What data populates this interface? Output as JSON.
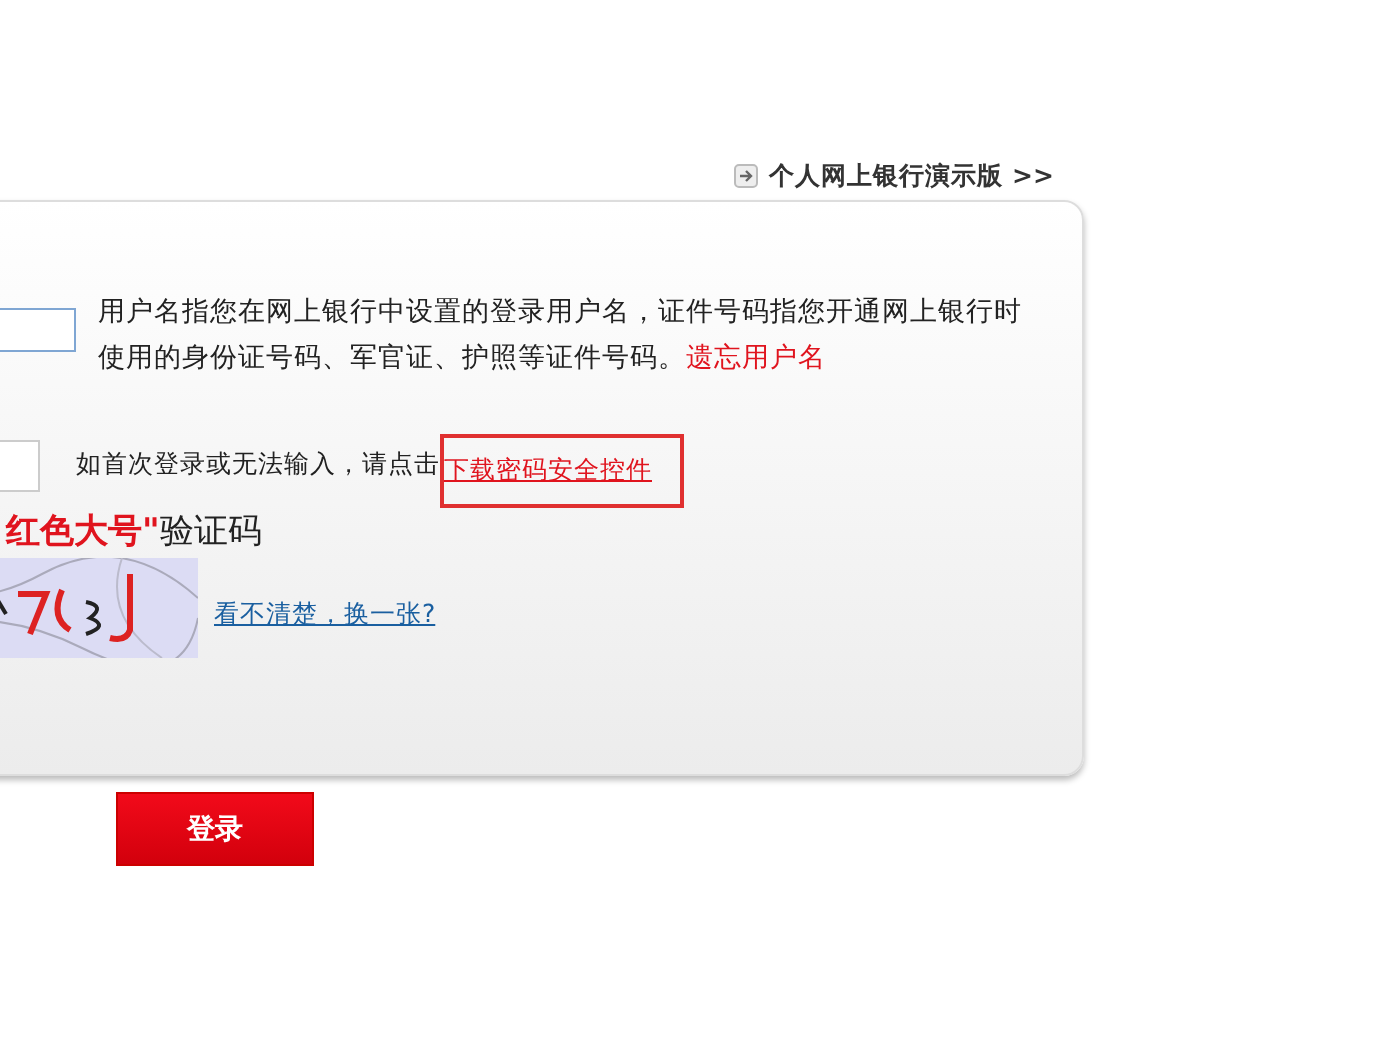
{
  "top_link": {
    "label": "个人网上银行演示版 >>"
  },
  "username_row": {
    "hint": "用户名指您在网上银行中设置的登录用户名，证件号码指您开通网上银行时使用的身份证号码、军官证、护照等证件号码。",
    "link": "遗忘用户名"
  },
  "password_row": {
    "hint": "如首次登录或无法输入，请点击",
    "link": "下载密码安全控件",
    "highlighted": true
  },
  "captcha": {
    "label_emphasis": "红色大号\"",
    "label": "验证码",
    "refresh_link": "看不清楚，换一张?"
  },
  "login_button": {
    "label": "登录"
  }
}
